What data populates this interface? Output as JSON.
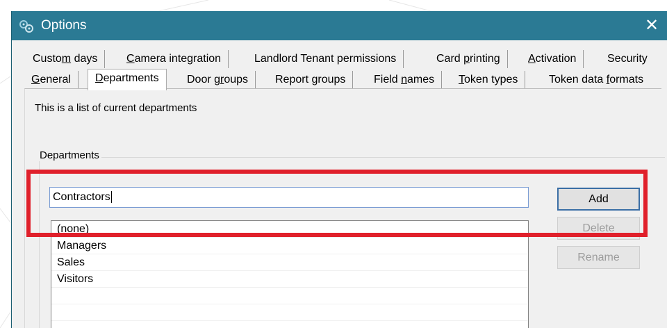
{
  "window": {
    "title": "Options",
    "close_glyph": "✕"
  },
  "tabs_row1": [
    "Custom days",
    "Camera integration",
    "Landlord Tenant permissions",
    "Card printing",
    "Activation",
    "Security"
  ],
  "tabs_row2": [
    "General",
    "Departments",
    "Door groups",
    "Report groups",
    "Field names",
    "Token types",
    "Token data formats"
  ],
  "active_tab": "Departments",
  "panel": {
    "description": "This is a list of current departments",
    "group_label": "Departments",
    "input_value": "Contractors",
    "list_items": [
      "(none)",
      "Managers",
      "Sales",
      "Visitors"
    ],
    "buttons": {
      "add": "Add",
      "delete": "Delete",
      "rename": "Rename"
    }
  },
  "colors": {
    "titlebar": "#2b7a94",
    "highlight": "#e0202b"
  },
  "icons": {
    "app": "gears-icon",
    "close": "close-icon"
  }
}
